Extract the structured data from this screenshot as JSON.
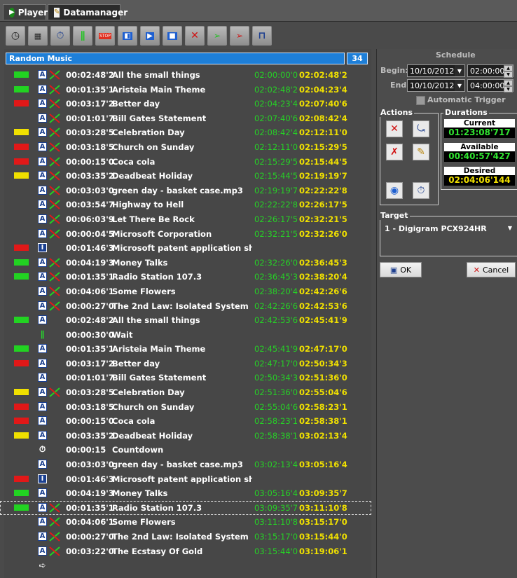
{
  "tabs": [
    {
      "label": "Player",
      "icon": "play-icon"
    },
    {
      "label": "Datamanager",
      "icon": "pencil-document-icon"
    }
  ],
  "toolbar": [
    "clock-icon",
    "calendar-icon",
    "stopwatch-icon",
    "pause-icon",
    "stop-icon",
    "play-prev-icon",
    "play-icon",
    "stop-square-icon",
    "crossfade-icon",
    "fade-in-icon",
    "fade-out-icon",
    "pulse-icon"
  ],
  "playlist": {
    "title": "Random Music",
    "count": "34",
    "rows": [
      {
        "color": "#22d322",
        "type": "A",
        "mix": true,
        "dur": "00:02:48'2",
        "title": "All the small things",
        "start": "02:00:00'0",
        "end": "02:02:48'2"
      },
      {
        "color": "#22d322",
        "type": "A",
        "mix": true,
        "dur": "00:01:35'1",
        "title": "Aristeia Main Theme",
        "start": "02:02:48'2",
        "end": "02:04:23'4"
      },
      {
        "color": "#e11818",
        "type": "A",
        "mix": true,
        "dur": "00:03:17'2",
        "title": "Better day",
        "start": "02:04:23'4",
        "end": "02:07:40'6"
      },
      {
        "color": "",
        "type": "A",
        "mix": true,
        "dur": "00:01:01'7",
        "title": "Bill Gates Statement",
        "start": "02:07:40'6",
        "end": "02:08:42'4"
      },
      {
        "color": "#f0e000",
        "type": "A",
        "mix": true,
        "dur": "00:03:28'5",
        "title": "Celebration Day",
        "start": "02:08:42'4",
        "end": "02:12:11'0"
      },
      {
        "color": "#e11818",
        "type": "A",
        "mix": true,
        "dur": "00:03:18'5",
        "title": "Church on Sunday",
        "start": "02:12:11'0",
        "end": "02:15:29'5"
      },
      {
        "color": "#e11818",
        "type": "A",
        "mix": true,
        "dur": "00:00:15'0",
        "title": "Coca cola",
        "start": "02:15:29'5",
        "end": "02:15:44'5"
      },
      {
        "color": "#f0e000",
        "type": "A",
        "mix": true,
        "dur": "00:03:35'2",
        "title": "Deadbeat Holiday",
        "start": "02:15:44'5",
        "end": "02:19:19'7"
      },
      {
        "color": "",
        "type": "A",
        "mix": true,
        "dur": "00:03:03'0",
        "title": "green day - basket case.mp3",
        "start": "02:19:19'7",
        "end": "02:22:22'8"
      },
      {
        "color": "",
        "type": "A",
        "mix": true,
        "dur": "00:03:54'7",
        "title": "Highway to Hell",
        "start": "02:22:22'8",
        "end": "02:26:17'5"
      },
      {
        "color": "",
        "type": "A",
        "mix": true,
        "dur": "00:06:03'9",
        "title": "Let There Be Rock",
        "start": "02:26:17'5",
        "end": "02:32:21'5"
      },
      {
        "color": "",
        "type": "A",
        "mix": true,
        "dur": "00:00:04'5",
        "title": "Microsoft Corporation",
        "start": "02:32:21'5",
        "end": "02:32:26'0"
      },
      {
        "color": "#e11818",
        "type": "I",
        "mix": false,
        "dur": "00:01:46'3",
        "title": "Microsoft patent application shows",
        "start": "",
        "end": ""
      },
      {
        "color": "#22d322",
        "type": "A",
        "mix": true,
        "dur": "00:04:19'3",
        "title": "Money Talks",
        "start": "02:32:26'0",
        "end": "02:36:45'3"
      },
      {
        "color": "#22d322",
        "type": "A",
        "mix": true,
        "dur": "00:01:35'1",
        "title": "Radio Station 107.3",
        "start": "02:36:45'3",
        "end": "02:38:20'4"
      },
      {
        "color": "",
        "type": "A",
        "mix": true,
        "dur": "00:04:06'1",
        "title": "Some Flowers",
        "start": "02:38:20'4",
        "end": "02:42:26'6"
      },
      {
        "color": "",
        "type": "A",
        "mix": true,
        "dur": "00:00:27'0",
        "title": "The 2nd Law: Isolated System",
        "start": "02:42:26'6",
        "end": "02:42:53'6"
      },
      {
        "color": "#22d322",
        "type": "A",
        "mix": false,
        "dur": "00:02:48'2",
        "title": "All the small things",
        "start": "02:42:53'6",
        "end": "02:45:41'9"
      },
      {
        "color": "",
        "type": "W",
        "mix": false,
        "dur": "00:00:30'0",
        "title": "Wait",
        "start": "",
        "end": ""
      },
      {
        "color": "#22d322",
        "type": "A",
        "mix": false,
        "dur": "00:01:35'1",
        "title": "Aristeia Main Theme",
        "start": "02:45:41'9",
        "end": "02:47:17'0"
      },
      {
        "color": "#e11818",
        "type": "A",
        "mix": false,
        "dur": "00:03:17'2",
        "title": "Better day",
        "start": "02:47:17'0",
        "end": "02:50:34'3"
      },
      {
        "color": "",
        "type": "A",
        "mix": false,
        "dur": "00:01:01'7",
        "title": "Bill Gates Statement",
        "start": "02:50:34'3",
        "end": "02:51:36'0"
      },
      {
        "color": "#f0e000",
        "type": "A",
        "mix": true,
        "dur": "00:03:28'5",
        "title": "Celebration Day",
        "start": "02:51:36'0",
        "end": "02:55:04'6"
      },
      {
        "color": "#e11818",
        "type": "A",
        "mix": false,
        "dur": "00:03:18'5",
        "title": "Church on Sunday",
        "start": "02:55:04'6",
        "end": "02:58:23'1"
      },
      {
        "color": "#e11818",
        "type": "A",
        "mix": false,
        "dur": "00:00:15'0",
        "title": "Coca cola",
        "start": "02:58:23'1",
        "end": "02:58:38'1"
      },
      {
        "color": "#f0e000",
        "type": "A",
        "mix": false,
        "dur": "00:03:35'2",
        "title": "Deadbeat Holiday",
        "start": "02:58:38'1",
        "end": "03:02:13'4"
      },
      {
        "color": "",
        "type": "C",
        "mix": false,
        "dur": "00:00:15",
        "title": "Countdown",
        "start": "",
        "end": ""
      },
      {
        "color": "",
        "type": "A",
        "mix": false,
        "dur": "00:03:03'0",
        "title": "green day - basket case.mp3",
        "start": "03:02:13'4",
        "end": "03:05:16'4"
      },
      {
        "color": "#e11818",
        "type": "I",
        "mix": false,
        "dur": "00:01:46'3",
        "title": "Microsoft patent application shows",
        "start": "",
        "end": ""
      },
      {
        "color": "#22d322",
        "type": "A",
        "mix": false,
        "dur": "00:04:19'3",
        "title": "Money Talks",
        "start": "03:05:16'4",
        "end": "03:09:35'7"
      },
      {
        "color": "#22d322",
        "type": "A",
        "mix": true,
        "dur": "00:01:35'1",
        "title": "Radio Station 107.3",
        "start": "03:09:35'7",
        "end": "03:11:10'8",
        "selected": true
      },
      {
        "color": "",
        "type": "A",
        "mix": true,
        "dur": "00:04:06'1",
        "title": "Some Flowers",
        "start": "03:11:10'8",
        "end": "03:15:17'0"
      },
      {
        "color": "",
        "type": "A",
        "mix": true,
        "dur": "00:00:27'0",
        "title": "The 2nd Law: Isolated System",
        "start": "03:15:17'0",
        "end": "03:15:44'0"
      },
      {
        "color": "",
        "type": "A",
        "mix": true,
        "dur": "00:03:22'0",
        "title": "The Ecstasy Of Gold",
        "start": "03:15:44'0",
        "end": "03:19:06'1"
      },
      {
        "color": "",
        "type": "E",
        "mix": false,
        "dur": "",
        "title": "",
        "start": "",
        "end": ""
      }
    ]
  },
  "schedule": {
    "heading": "Schedule",
    "begin_label": "Begin:",
    "begin_date": "10/10/2012",
    "begin_time": "02:00:00",
    "end_label": "End:",
    "end_date": "10/10/2012",
    "end_time": "04:00:00",
    "auto_trigger": "Automatic Trigger"
  },
  "actions": {
    "heading": "Actions"
  },
  "durations": {
    "heading": "Durations",
    "current_label": "Current",
    "current": "01:23:08'717",
    "available_label": "Available",
    "available": "00:40:57'427",
    "desired_label": "Desired",
    "desired": "02:04:06'144"
  },
  "target": {
    "heading": "Target",
    "value": "1 - Digigram PCX924HR"
  },
  "buttons": {
    "ok": "OK",
    "cancel": "Cancel"
  }
}
